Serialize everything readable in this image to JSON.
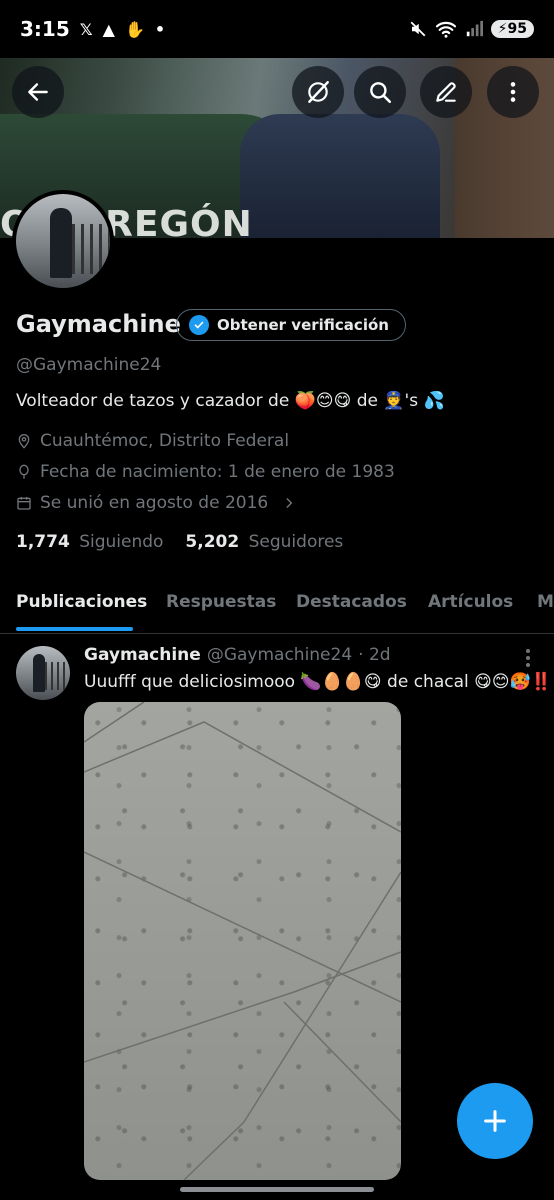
{
  "status_bar": {
    "time": "3:15",
    "left_icons": [
      "x-logo-icon",
      "warning-icon",
      "handshake-icon",
      "dot-icon"
    ],
    "battery": "95",
    "right_icons": [
      "mute-icon",
      "wifi-icon",
      "signal-icon"
    ]
  },
  "banner": {
    "text": "O OBREGÓN",
    "buttons": [
      "back-arrow-icon",
      "grok-icon",
      "search-icon",
      "edit-icon",
      "more-vertical-icon"
    ]
  },
  "profile": {
    "display_name": "Gaymachine",
    "verify_label": "Obtener verificación",
    "handle": "@Gaymachine24",
    "bio": "Volteador de tazos y cazador de 🍑😊😋 de 👮's 💦",
    "location": "Cuauhtémoc, Distrito Federal",
    "birthday": "Fecha de nacimiento: 1 de enero de 1983",
    "joined": "Se unió en agosto de 2016",
    "following_count": "1,774",
    "following_label": "Siguiendo",
    "followers_count": "5,202",
    "followers_label": "Seguidores"
  },
  "tabs": [
    "Publicaciones",
    "Respuestas",
    "Destacados",
    "Artículos",
    "M"
  ],
  "post": {
    "name": "Gaymachine",
    "handle": "@Gaymachine24",
    "time": "· 2d",
    "text": "Uuufff que deliciosimooo 🍆🥚🥚😋 de chacal 😋😊🥵‼️"
  },
  "colors": {
    "accent": "#1d9bf0",
    "text_primary": "#e7e9ea",
    "text_secondary": "#71767b",
    "border": "#2f3336",
    "background": "#000000"
  }
}
